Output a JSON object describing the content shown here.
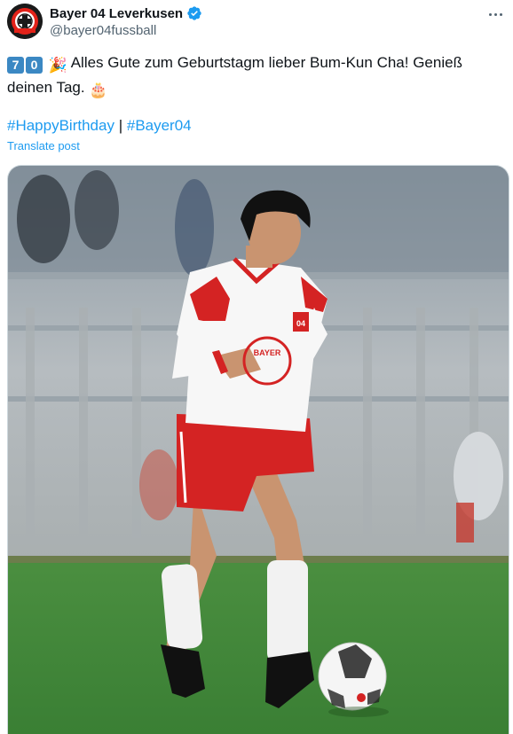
{
  "author": {
    "display_name": "Bayer 04 Leverkusen",
    "handle": "@bayer04fussball",
    "verified_icon": "verified-badge-icon",
    "avatar_icon": "bayer04-crest-icon"
  },
  "post": {
    "keycap_1": "7",
    "keycap_2": "0",
    "party_emoji": "🎉",
    "message": "Alles Gute zum Geburtstagm lieber Bum-Kun Cha! Genieß deinen Tag.",
    "cake_emoji": "🎂",
    "hashtag_1": "#HappyBirthday",
    "separator": "|",
    "hashtag_2": "#Bayer04",
    "translate_label": "Translate post"
  },
  "media": {
    "jersey_text": "BAYER",
    "badge_text": "04"
  },
  "colors": {
    "link": "#1d9bf0",
    "text": "#0f1419",
    "muted": "#536471",
    "pitch": "#3f8a3a",
    "kit_red": "#d42323"
  }
}
